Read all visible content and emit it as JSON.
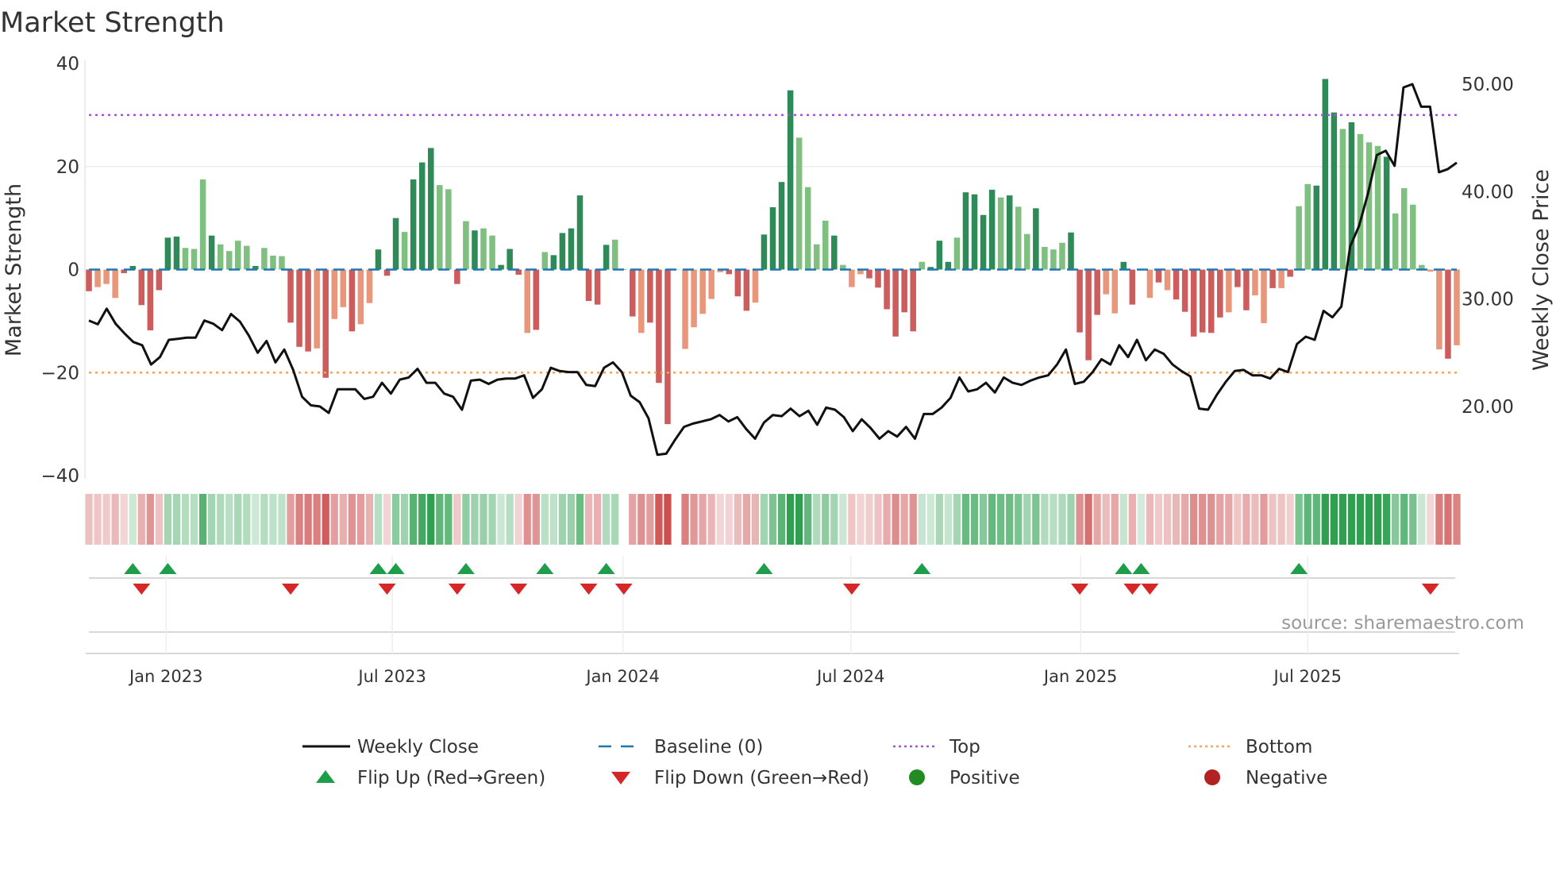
{
  "chart_data": {
    "type": "bar",
    "title": "Market Strength",
    "ylabel": "Market Strength",
    "y2label": "Weekly Close Price",
    "ylim": [
      -40,
      40
    ],
    "y2lim": [
      13.5,
      52.6
    ],
    "yticks": [
      "40",
      "20",
      "0",
      "−20",
      "−40"
    ],
    "ytick_values": [
      40,
      20,
      0,
      -20,
      -40
    ],
    "y2ticks": [
      "50.00",
      "40.00",
      "30.00",
      "20.00"
    ],
    "y2tick_values": [
      50,
      40,
      30,
      20
    ],
    "top_level": 30,
    "bottom_level": -20,
    "xticks": [
      {
        "label": "Jan 2023",
        "week": 8.8
      },
      {
        "label": "Jul 2023",
        "week": 34.6
      },
      {
        "label": "Jan 2024",
        "week": 60.9
      },
      {
        "label": "Jul 2024",
        "week": 86.9
      },
      {
        "label": "Jan 2025",
        "week": 113.1
      },
      {
        "label": "Jul 2025",
        "week": 139.0
      }
    ],
    "strength": [
      -4.2,
      -3.4,
      -2.8,
      -5.5,
      -0.7,
      0.7,
      -6.9,
      -11.8,
      -4,
      6.2,
      6.4,
      4.2,
      4.0,
      17.5,
      6.6,
      4.9,
      3.6,
      5.6,
      4.6,
      0.7,
      4.2,
      2.7,
      2.6,
      -10.3,
      -15,
      -15.9,
      -15.3,
      -21,
      -9.6,
      -7.3,
      -12,
      -10.6,
      -6.5,
      3.9,
      -1.2,
      10,
      7.3,
      17.5,
      20.8,
      23.6,
      16.4,
      15.6,
      -2.8,
      9.4,
      7.6,
      8,
      6.6,
      0.9,
      4,
      -1,
      -12.3,
      -11.7,
      3.4,
      2.8,
      7.1,
      8,
      14.4,
      -6.1,
      -6.8,
      4.8,
      5.8,
      0,
      -9.1,
      -12.3,
      -10.3,
      -22,
      -30,
      0,
      -15.4,
      -11.2,
      -8.6,
      -5.7,
      -0.5,
      -0.9,
      -5.2,
      -8,
      -6.4,
      6.8,
      12.1,
      17,
      34.8,
      25.6,
      16,
      4.9,
      9.5,
      6.6,
      0.9,
      -3.4,
      -0.9,
      -1.7,
      -3.5,
      -7.7,
      -13,
      -8.3,
      -12,
      1.5,
      0.5,
      5.6,
      1.5,
      6.2,
      15,
      14.6,
      10.6,
      15.5,
      14,
      14.4,
      12.2,
      6.9,
      11.9,
      4.4,
      3.9,
      5.2,
      7.2,
      -12.2,
      -17.6,
      -8.8,
      -4.8,
      -8.5,
      1.5,
      -6.8,
      0.1,
      -5.5,
      -2.5,
      -4,
      -5.8,
      -8.2,
      -13,
      -12.2,
      -12.3,
      -9.3,
      -8.3,
      -3.4,
      -7.9,
      -5,
      -10.4,
      -3.6,
      -3.6,
      -1.4,
      12.3,
      16.6,
      16.3,
      37,
      30.5,
      27.3,
      28.6,
      26.3,
      24.7,
      24,
      21.9,
      10.9,
      15.8,
      12.6,
      0.9,
      -0.4,
      -15.5,
      -17.3,
      -14.7
    ],
    "strong": "dllldddddddllldlllldllldddldlldlldddldddlldldlldddldldddddddxddldddxllllldddlddddlllldlllddddddldddlddddldlldlllddddlldddldlddddddlddlldldlldddldllldlllllldldddddl",
    "weekly_close": [
      28.0,
      27.65,
      29.1,
      27.7,
      26.8,
      26.0,
      25.7,
      23.9,
      24.6,
      26.2,
      26.3,
      26.4,
      26.4,
      28.0,
      27.7,
      27.1,
      28.6,
      27.9,
      26.6,
      25.0,
      26.1,
      24.1,
      25.3,
      23.4,
      20.9,
      20.1,
      20.0,
      19.4,
      21.6,
      21.6,
      21.6,
      20.7,
      20.9,
      22.2,
      21.2,
      22.5,
      22.7,
      23.5,
      22.2,
      22.2,
      21.2,
      20.9,
      19.7,
      22.4,
      22.5,
      22.1,
      22.5,
      22.6,
      22.6,
      22.9,
      20.8,
      21.6,
      23.6,
      23.3,
      23.2,
      23.2,
      22.0,
      21.9,
      23.6,
      24.1,
      23.2,
      21.0,
      20.4,
      18.9,
      15.5,
      15.6,
      16.9,
      18.1,
      18.4,
      18.6,
      18.8,
      19.2,
      18.6,
      19.0,
      17.9,
      17.0,
      18.5,
      19.2,
      19.1,
      19.8,
      19.1,
      19.6,
      18.3,
      19.9,
      19.7,
      19.0,
      17.7,
      18.8,
      18.0,
      17.0,
      17.7,
      17.2,
      18.1,
      17.0,
      19.3,
      19.3,
      19.9,
      20.8,
      22.7,
      21.4,
      21.6,
      22.2,
      21.3,
      22.7,
      22.2,
      22.0,
      22.4,
      22.7,
      22.9,
      23.9,
      25.3,
      22.1,
      22.3,
      23.2,
      24.4,
      23.9,
      25.7,
      24.6,
      26.2,
      24.3,
      25.3,
      24.9,
      23.9,
      23.3,
      22.8,
      19.8,
      19.7,
      21.1,
      22.3,
      23.3,
      23.4,
      22.9,
      22.9,
      22.6,
      23.5,
      23.2,
      25.8,
      26.5,
      26.2,
      28.9,
      28.3,
      29.3,
      34.9,
      36.8,
      39.8,
      43.4,
      43.8,
      42.4,
      49.7,
      50.0,
      47.9,
      47.9,
      41.8,
      42.1,
      42.7
    ],
    "flip_up_weeks": [
      5,
      9,
      33,
      35,
      43,
      52,
      59,
      77,
      95,
      118,
      120,
      138
    ],
    "flip_down_weeks": [
      6,
      23,
      34,
      42,
      49,
      57,
      61,
      87,
      113,
      119,
      121,
      153
    ],
    "legend": [
      {
        "key": "close",
        "label": "Weekly Close"
      },
      {
        "key": "baseline",
        "label": "Baseline (0)"
      },
      {
        "key": "top",
        "label": "Top"
      },
      {
        "key": "bottom",
        "label": "Bottom"
      },
      {
        "key": "flipup",
        "label": "Flip Up (Red→Green)"
      },
      {
        "key": "flipdown",
        "label": "Flip Down (Green→Red)"
      },
      {
        "key": "positive",
        "label": "Positive"
      },
      {
        "key": "negative",
        "label": "Negative"
      }
    ],
    "legend_placement": "bottom",
    "source": "source: sharemaestro.com",
    "colors": {
      "pos_strong": "#2e8b57",
      "pos_weak": "#7fbf7f",
      "neg_strong": "#cd5c5c",
      "neg_weak": "#e9967a",
      "baseline": "#1f77b4",
      "top": "#9b59d6",
      "bottom": "#f4a460",
      "close": "#111111",
      "flip_up": "#1e9e4a",
      "flip_down": "#d62728",
      "positive": "#228b22",
      "negative": "#b22222"
    }
  }
}
